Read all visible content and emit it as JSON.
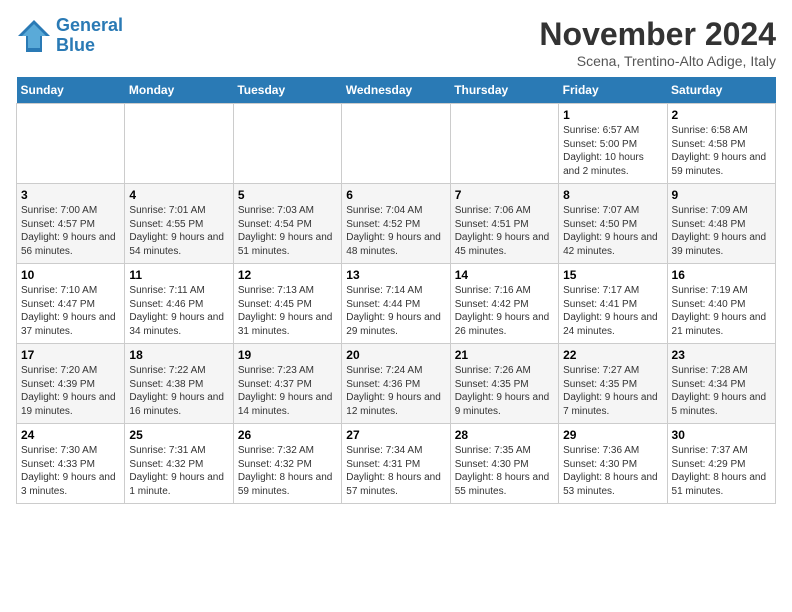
{
  "header": {
    "logo_line1": "General",
    "logo_line2": "Blue",
    "month_title": "November 2024",
    "location": "Scena, Trentino-Alto Adige, Italy"
  },
  "days_of_week": [
    "Sunday",
    "Monday",
    "Tuesday",
    "Wednesday",
    "Thursday",
    "Friday",
    "Saturday"
  ],
  "weeks": [
    [
      {
        "day": "",
        "info": ""
      },
      {
        "day": "",
        "info": ""
      },
      {
        "day": "",
        "info": ""
      },
      {
        "day": "",
        "info": ""
      },
      {
        "day": "",
        "info": ""
      },
      {
        "day": "1",
        "info": "Sunrise: 6:57 AM\nSunset: 5:00 PM\nDaylight: 10 hours and 2 minutes."
      },
      {
        "day": "2",
        "info": "Sunrise: 6:58 AM\nSunset: 4:58 PM\nDaylight: 9 hours and 59 minutes."
      }
    ],
    [
      {
        "day": "3",
        "info": "Sunrise: 7:00 AM\nSunset: 4:57 PM\nDaylight: 9 hours and 56 minutes."
      },
      {
        "day": "4",
        "info": "Sunrise: 7:01 AM\nSunset: 4:55 PM\nDaylight: 9 hours and 54 minutes."
      },
      {
        "day": "5",
        "info": "Sunrise: 7:03 AM\nSunset: 4:54 PM\nDaylight: 9 hours and 51 minutes."
      },
      {
        "day": "6",
        "info": "Sunrise: 7:04 AM\nSunset: 4:52 PM\nDaylight: 9 hours and 48 minutes."
      },
      {
        "day": "7",
        "info": "Sunrise: 7:06 AM\nSunset: 4:51 PM\nDaylight: 9 hours and 45 minutes."
      },
      {
        "day": "8",
        "info": "Sunrise: 7:07 AM\nSunset: 4:50 PM\nDaylight: 9 hours and 42 minutes."
      },
      {
        "day": "9",
        "info": "Sunrise: 7:09 AM\nSunset: 4:48 PM\nDaylight: 9 hours and 39 minutes."
      }
    ],
    [
      {
        "day": "10",
        "info": "Sunrise: 7:10 AM\nSunset: 4:47 PM\nDaylight: 9 hours and 37 minutes."
      },
      {
        "day": "11",
        "info": "Sunrise: 7:11 AM\nSunset: 4:46 PM\nDaylight: 9 hours and 34 minutes."
      },
      {
        "day": "12",
        "info": "Sunrise: 7:13 AM\nSunset: 4:45 PM\nDaylight: 9 hours and 31 minutes."
      },
      {
        "day": "13",
        "info": "Sunrise: 7:14 AM\nSunset: 4:44 PM\nDaylight: 9 hours and 29 minutes."
      },
      {
        "day": "14",
        "info": "Sunrise: 7:16 AM\nSunset: 4:42 PM\nDaylight: 9 hours and 26 minutes."
      },
      {
        "day": "15",
        "info": "Sunrise: 7:17 AM\nSunset: 4:41 PM\nDaylight: 9 hours and 24 minutes."
      },
      {
        "day": "16",
        "info": "Sunrise: 7:19 AM\nSunset: 4:40 PM\nDaylight: 9 hours and 21 minutes."
      }
    ],
    [
      {
        "day": "17",
        "info": "Sunrise: 7:20 AM\nSunset: 4:39 PM\nDaylight: 9 hours and 19 minutes."
      },
      {
        "day": "18",
        "info": "Sunrise: 7:22 AM\nSunset: 4:38 PM\nDaylight: 9 hours and 16 minutes."
      },
      {
        "day": "19",
        "info": "Sunrise: 7:23 AM\nSunset: 4:37 PM\nDaylight: 9 hours and 14 minutes."
      },
      {
        "day": "20",
        "info": "Sunrise: 7:24 AM\nSunset: 4:36 PM\nDaylight: 9 hours and 12 minutes."
      },
      {
        "day": "21",
        "info": "Sunrise: 7:26 AM\nSunset: 4:35 PM\nDaylight: 9 hours and 9 minutes."
      },
      {
        "day": "22",
        "info": "Sunrise: 7:27 AM\nSunset: 4:35 PM\nDaylight: 9 hours and 7 minutes."
      },
      {
        "day": "23",
        "info": "Sunrise: 7:28 AM\nSunset: 4:34 PM\nDaylight: 9 hours and 5 minutes."
      }
    ],
    [
      {
        "day": "24",
        "info": "Sunrise: 7:30 AM\nSunset: 4:33 PM\nDaylight: 9 hours and 3 minutes."
      },
      {
        "day": "25",
        "info": "Sunrise: 7:31 AM\nSunset: 4:32 PM\nDaylight: 9 hours and 1 minute."
      },
      {
        "day": "26",
        "info": "Sunrise: 7:32 AM\nSunset: 4:32 PM\nDaylight: 8 hours and 59 minutes."
      },
      {
        "day": "27",
        "info": "Sunrise: 7:34 AM\nSunset: 4:31 PM\nDaylight: 8 hours and 57 minutes."
      },
      {
        "day": "28",
        "info": "Sunrise: 7:35 AM\nSunset: 4:30 PM\nDaylight: 8 hours and 55 minutes."
      },
      {
        "day": "29",
        "info": "Sunrise: 7:36 AM\nSunset: 4:30 PM\nDaylight: 8 hours and 53 minutes."
      },
      {
        "day": "30",
        "info": "Sunrise: 7:37 AM\nSunset: 4:29 PM\nDaylight: 8 hours and 51 minutes."
      }
    ]
  ]
}
